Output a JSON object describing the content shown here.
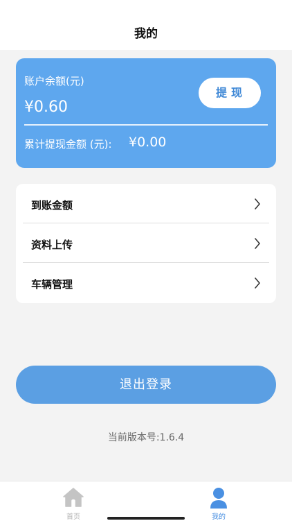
{
  "header": {
    "title": "我的"
  },
  "balance_card": {
    "balance_label": "账户余额(元)",
    "balance_value": "¥0.60",
    "withdraw_label": "提现",
    "cumulative_label": "累计提现金额 (元):",
    "cumulative_value": "¥0.00"
  },
  "menu": {
    "items": [
      {
        "label": "到账金额"
      },
      {
        "label": "资料上传"
      },
      {
        "label": "车辆管理"
      }
    ]
  },
  "logout_label": "退出登录",
  "version_text": "当前版本号:1.6.4",
  "tabbar": {
    "home_label": "首页",
    "mine_label": "我的",
    "active_tab": "mine"
  },
  "colors": {
    "accent": "#5ea7ee",
    "button": "#5b9fe3",
    "active_tab": "#4a90e2",
    "inactive_tab": "#b5b5b5",
    "background": "#f3f3f3"
  },
  "icons": {
    "chevron": "chevron-right-icon",
    "home": "home-icon",
    "mine": "user-icon"
  }
}
